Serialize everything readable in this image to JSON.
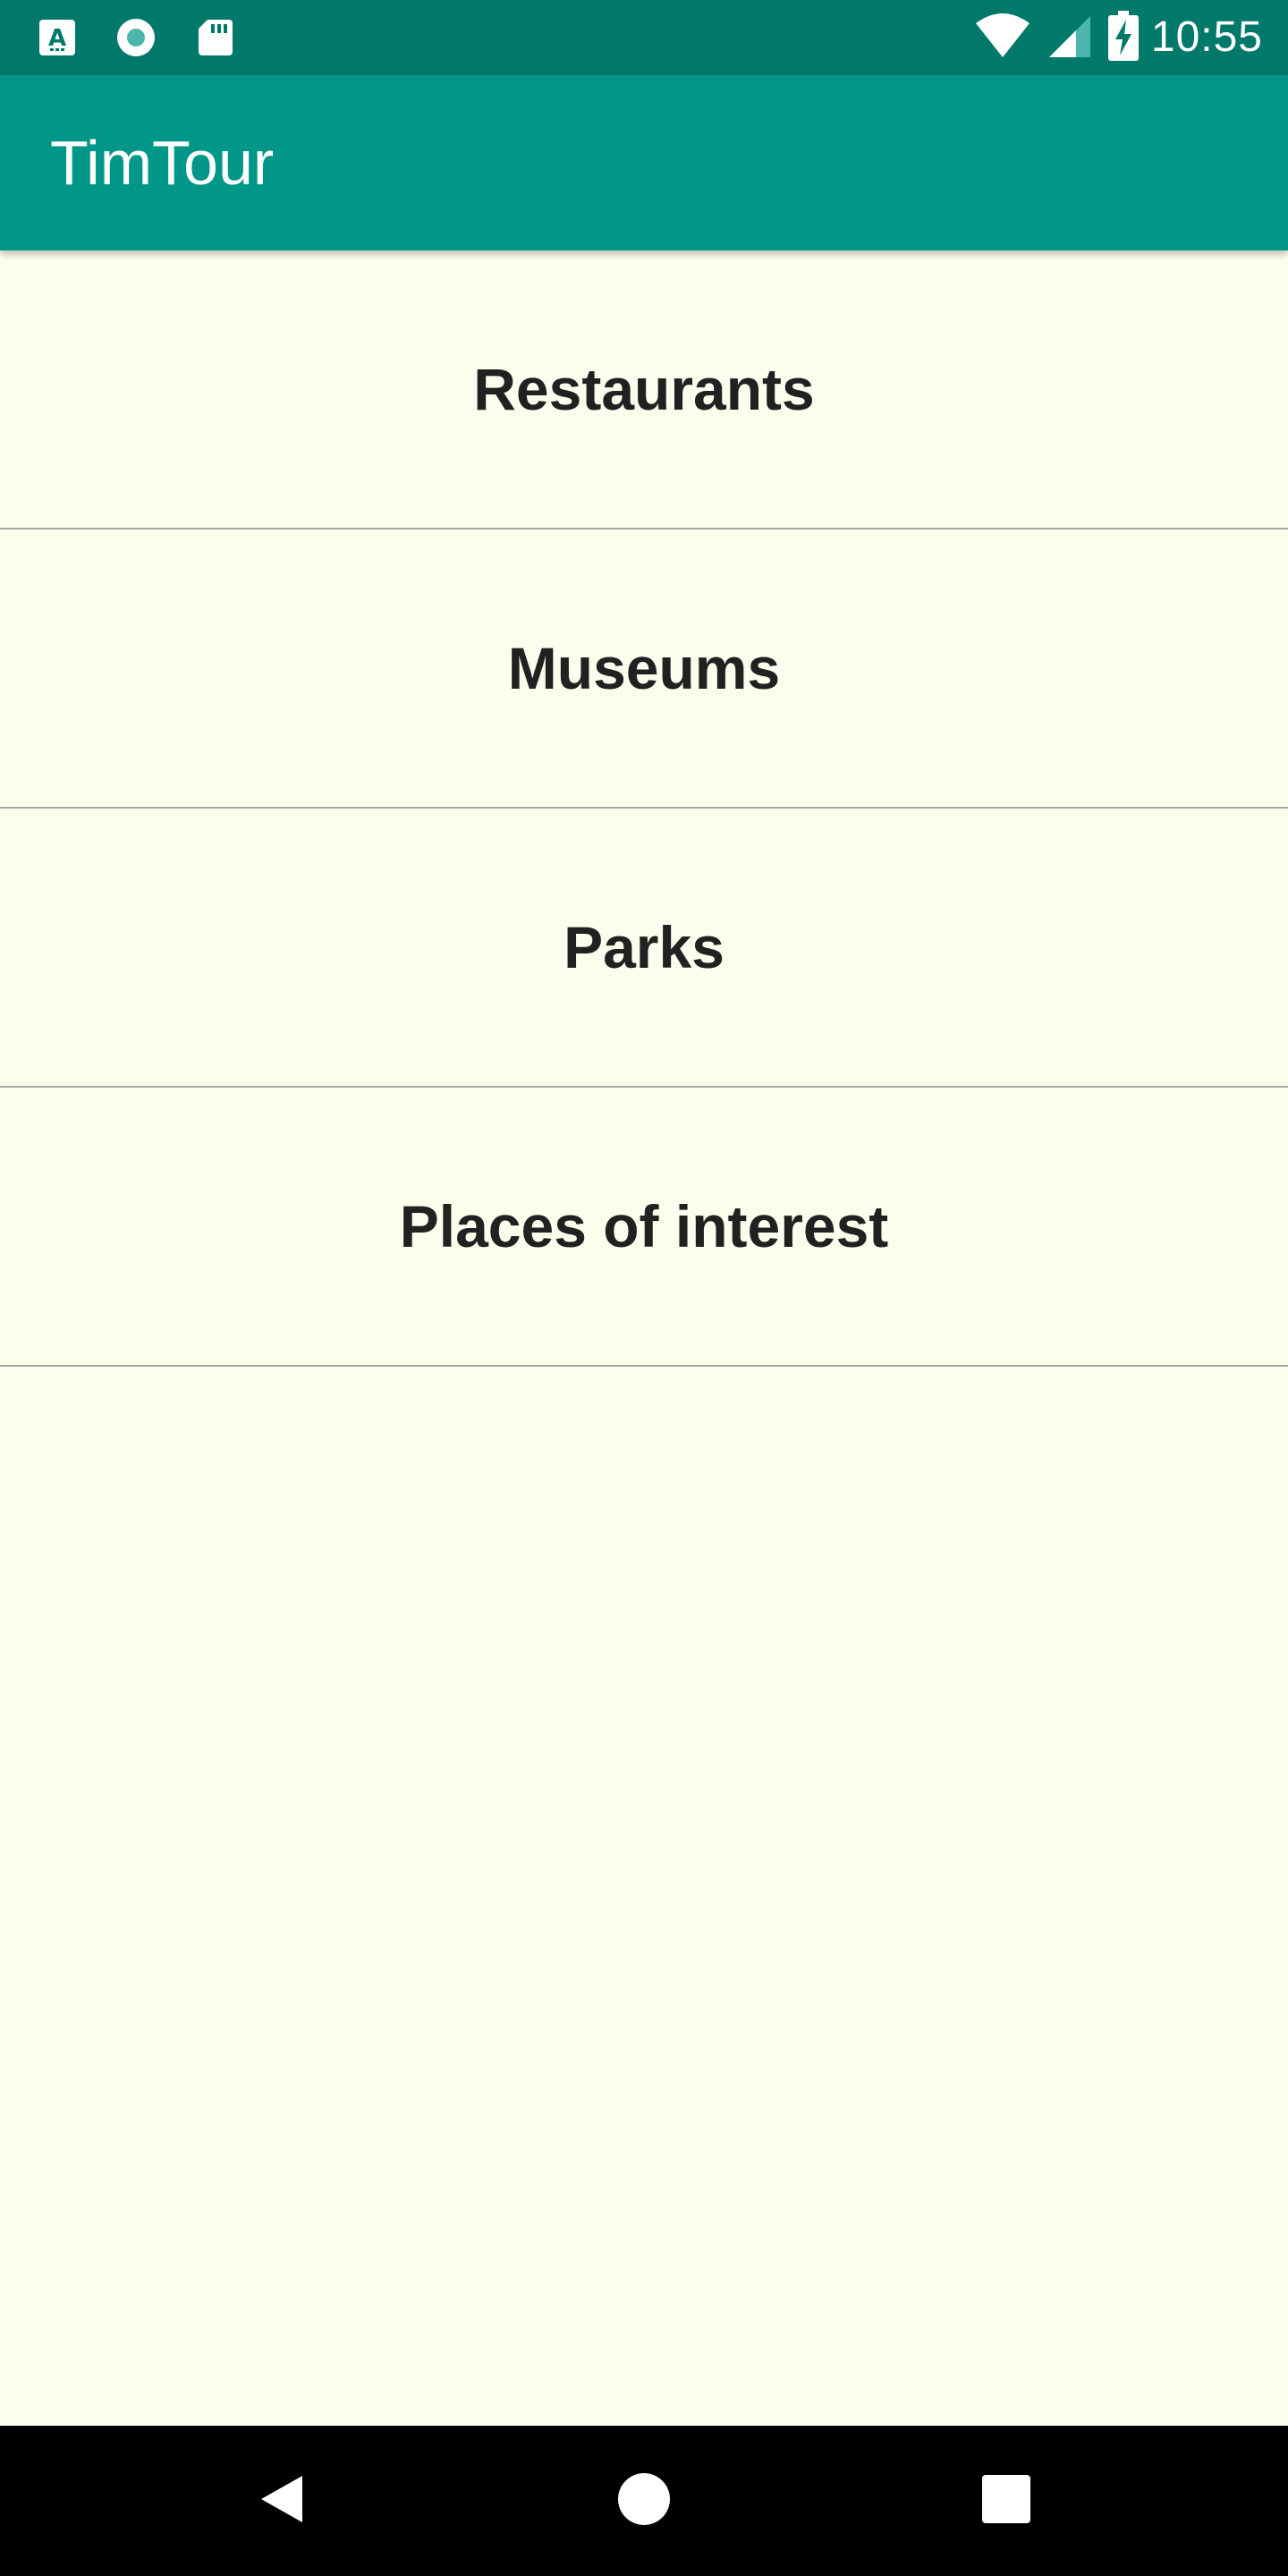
{
  "status_bar": {
    "time": "10:55",
    "left_icons": [
      "text-a-icon",
      "record-circle-icon",
      "sd-card-icon"
    ],
    "right_icons": [
      "wifi-icon",
      "cell-signal-icon",
      "battery-charging-icon"
    ]
  },
  "app_bar": {
    "title": "TimTour"
  },
  "categories": [
    {
      "label": "Restaurants"
    },
    {
      "label": "Museums"
    },
    {
      "label": "Parks"
    },
    {
      "label": "Places of interest"
    }
  ],
  "nav_bar": {
    "buttons": [
      "back-icon",
      "home-icon",
      "recents-icon"
    ]
  },
  "colors": {
    "status_bar": "#00796b",
    "app_bar": "#009688",
    "background": "#fdfdee",
    "text": "#212121",
    "divider": "#a8a8a4",
    "nav_bar": "#000000"
  }
}
